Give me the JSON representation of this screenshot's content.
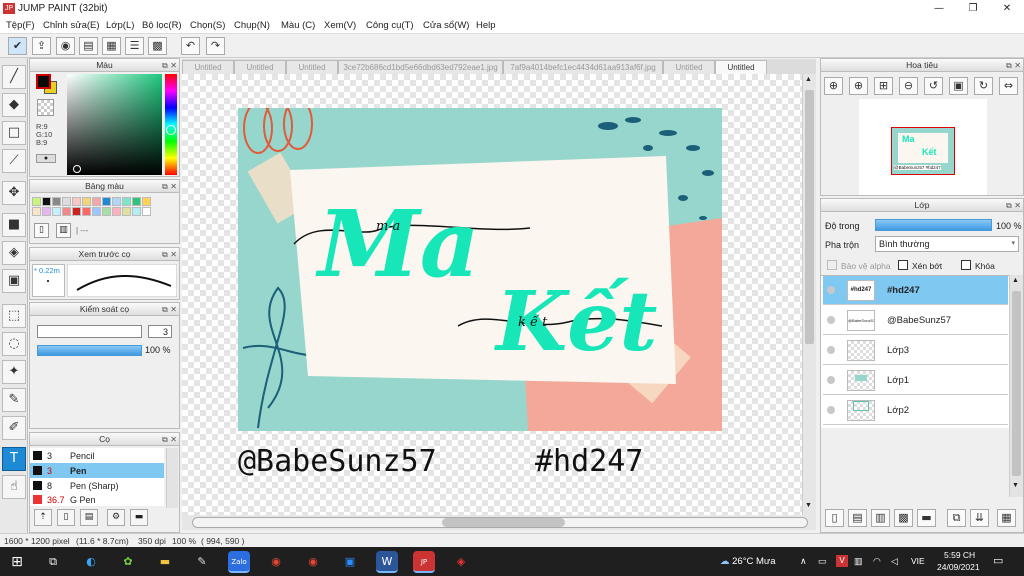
{
  "window": {
    "title": "JUMP PAINT (32bit)",
    "app_icon_text": "JP"
  },
  "window_controls": {
    "minimize": "—",
    "restore": "❐",
    "close": "✕"
  },
  "menu": [
    "Tệp(F)",
    "Chỉnh sửa(E)",
    "Lớp(L)",
    "Bộ lọc(R)",
    "Chọn(S)",
    "Chụp(N)",
    "Màu (C)",
    "Xem(V)",
    "Công cụ(T)",
    "Cửa sổ(W)",
    "Help"
  ],
  "doc_tabs": [
    "Untitled",
    "Untitled",
    "Untitled",
    "3ce72b686cd1bd5e66dbd63ed792eae1.jpg",
    "7af9a4014befc1ec4434d61aa913af6f.jpg",
    "Untitled",
    "Untitled"
  ],
  "panels": {
    "color": "Màu",
    "swatches": "Bảng màu",
    "brush_preview": "Xem trước cọ",
    "brush_control": "Kiểm soát cọ",
    "brushes": "Cọ",
    "navigator": "Hoa tiêu",
    "layers": "Lớp"
  },
  "color_readout": {
    "r": "R:9",
    "g": "G:10",
    "b": "B:9"
  },
  "brush_preview_size": "* 0.22m",
  "brush_control": {
    "size": "3",
    "opacity": "100 %"
  },
  "brush_list": [
    {
      "size": "3",
      "name": "Pencil",
      "selected": false
    },
    {
      "size": "3",
      "name": "Pen",
      "selected": true
    },
    {
      "size": "8",
      "name": "Pen (Sharp)",
      "selected": false
    },
    {
      "size": "36.7",
      "name": "G Pen",
      "selected": false
    }
  ],
  "layers_panel": {
    "opacity_label": "Độ trong",
    "opacity_value": "100 %",
    "blend_label": "Pha trộn",
    "blend_value": "Bình thường",
    "protect_alpha": "Bảo vệ alpha",
    "clip": "Xén bớt",
    "lock": "Khóa",
    "layers": [
      {
        "name": "#hd247",
        "thumb": "#hd247",
        "selected": true
      },
      {
        "name": "@BabeSunz57",
        "thumb": "@BabeSunz57",
        "selected": false
      },
      {
        "name": "Lớp3",
        "thumb": "",
        "selected": false
      },
      {
        "name": "Lớp1",
        "thumb": "",
        "selected": false
      },
      {
        "name": "Lớp2",
        "thumb": "",
        "selected": false
      }
    ]
  },
  "navigator_thumb": {
    "line1": "Ma",
    "line2": "Kết",
    "caption": "@BabeSunz57 #hd247"
  },
  "artwork": {
    "word1": "Ma",
    "word1_script": "m a",
    "word2": "Kết",
    "word2_script": "k ế t",
    "handle": "@BabeSunz57",
    "hashtag": "#hd247"
  },
  "status": {
    "size": "1600 * 1200 pixel",
    "physical": "(11.6 * 8.7cm)",
    "dpi": "350 dpi",
    "zoom": "100 %",
    "coords": "( 994, 590 )"
  },
  "taskbar": {
    "weather": "26°C Mưa",
    "ime": "VIE",
    "time": "5:59 CH",
    "date": "24/09/2021"
  },
  "colors": {
    "accent": "#1e8ad6",
    "layer_selected": "#7ec8f2",
    "teal": "#97d6cc",
    "coral": "#f4a89a",
    "mint_text": "#17e6b9"
  },
  "icons": {
    "left_tools": [
      "brush-icon",
      "eraser-icon",
      "select-rect-icon",
      "line-icon",
      "move-icon",
      "fill-rect-icon",
      "bucket-icon",
      "gradient-icon",
      "marquee-icon",
      "lasso-icon",
      "magic-wand-icon",
      "selection-pen-icon",
      "selection-eraser-icon",
      "text-icon",
      "operation-icon"
    ]
  }
}
